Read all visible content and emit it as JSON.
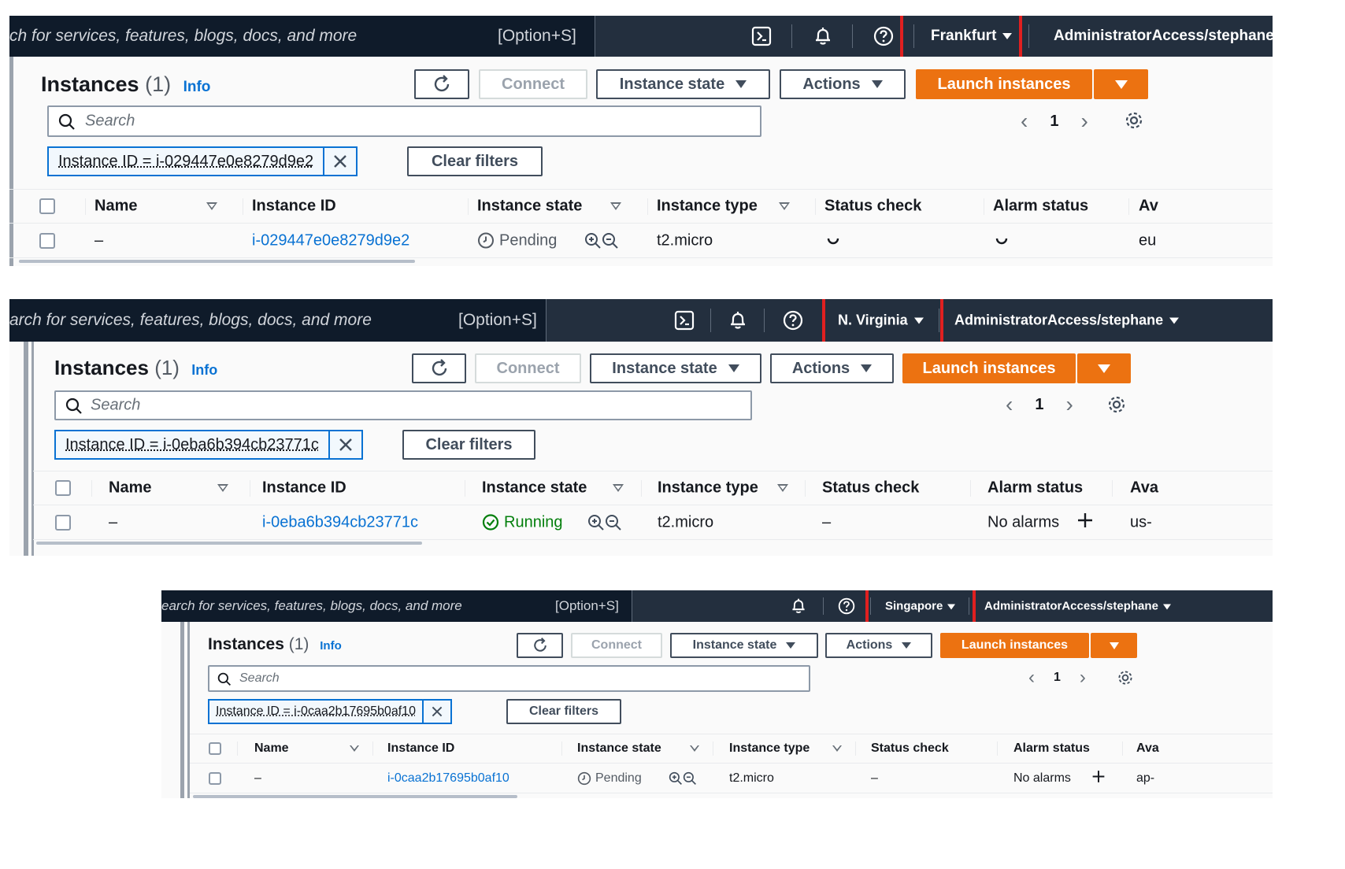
{
  "common": {
    "search_kbd": "[Option+S]",
    "account": "AdministratorAccess/stephane",
    "page_title": "Instances",
    "instance_count": "(1)",
    "info_link": "Info",
    "connect": "Connect",
    "instance_state_btn": "Instance state",
    "actions": "Actions",
    "launch": "Launch instances",
    "search_placeholder": "Search",
    "page_number": "1",
    "clear_filters": "Clear filters",
    "columns": [
      "Name",
      "Instance ID",
      "Instance state",
      "Instance type",
      "Status check",
      "Alarm status"
    ],
    "col_ava_1": "Av",
    "col_ava_2": "Ava",
    "col_ava_3": "Ava"
  },
  "panels": [
    {
      "search_text": "ch for services, features, blogs, docs, and more",
      "region": "Frankfurt",
      "filter": "Instance ID = i-029447e0e8279d9e2",
      "row": {
        "name": "–",
        "instance_id": "i-029447e0e8279d9e2",
        "state": "Pending",
        "type": "t2.micro",
        "status_check": "",
        "alarm": "",
        "az": "eu"
      }
    },
    {
      "search_text": "arch for services, features, blogs, docs, and more",
      "region": "N. Virginia",
      "filter": "Instance ID = i-0eba6b394cb23771c",
      "row": {
        "name": "–",
        "instance_id": "i-0eba6b394cb23771c",
        "state": "Running",
        "type": "t2.micro",
        "status_check": "–",
        "alarm": "No alarms",
        "az": "us-"
      }
    },
    {
      "search_text": "earch for services, features, blogs, docs, and more",
      "region": "Singapore",
      "filter": "Instance ID = i-0caa2b17695b0af10",
      "row": {
        "name": "–",
        "instance_id": "i-0caa2b17695b0af10",
        "state": "Pending",
        "type": "t2.micro",
        "status_check": "–",
        "alarm": "No alarms",
        "az": "ap-"
      }
    }
  ],
  "colors": {
    "nav": "#232f3e",
    "accent": "#ec7211",
    "link": "#0972d3",
    "running": "#037f0c",
    "highlight": "#e02020"
  },
  "icons": [
    "cloudshell-icon",
    "bell-icon",
    "help-icon",
    "refresh-icon",
    "search-icon",
    "settings-icon",
    "close-icon",
    "clock-icon",
    "check-circle-icon",
    "zoom-in-icon",
    "zoom-out-icon",
    "add-icon",
    "spinner-icon"
  ]
}
